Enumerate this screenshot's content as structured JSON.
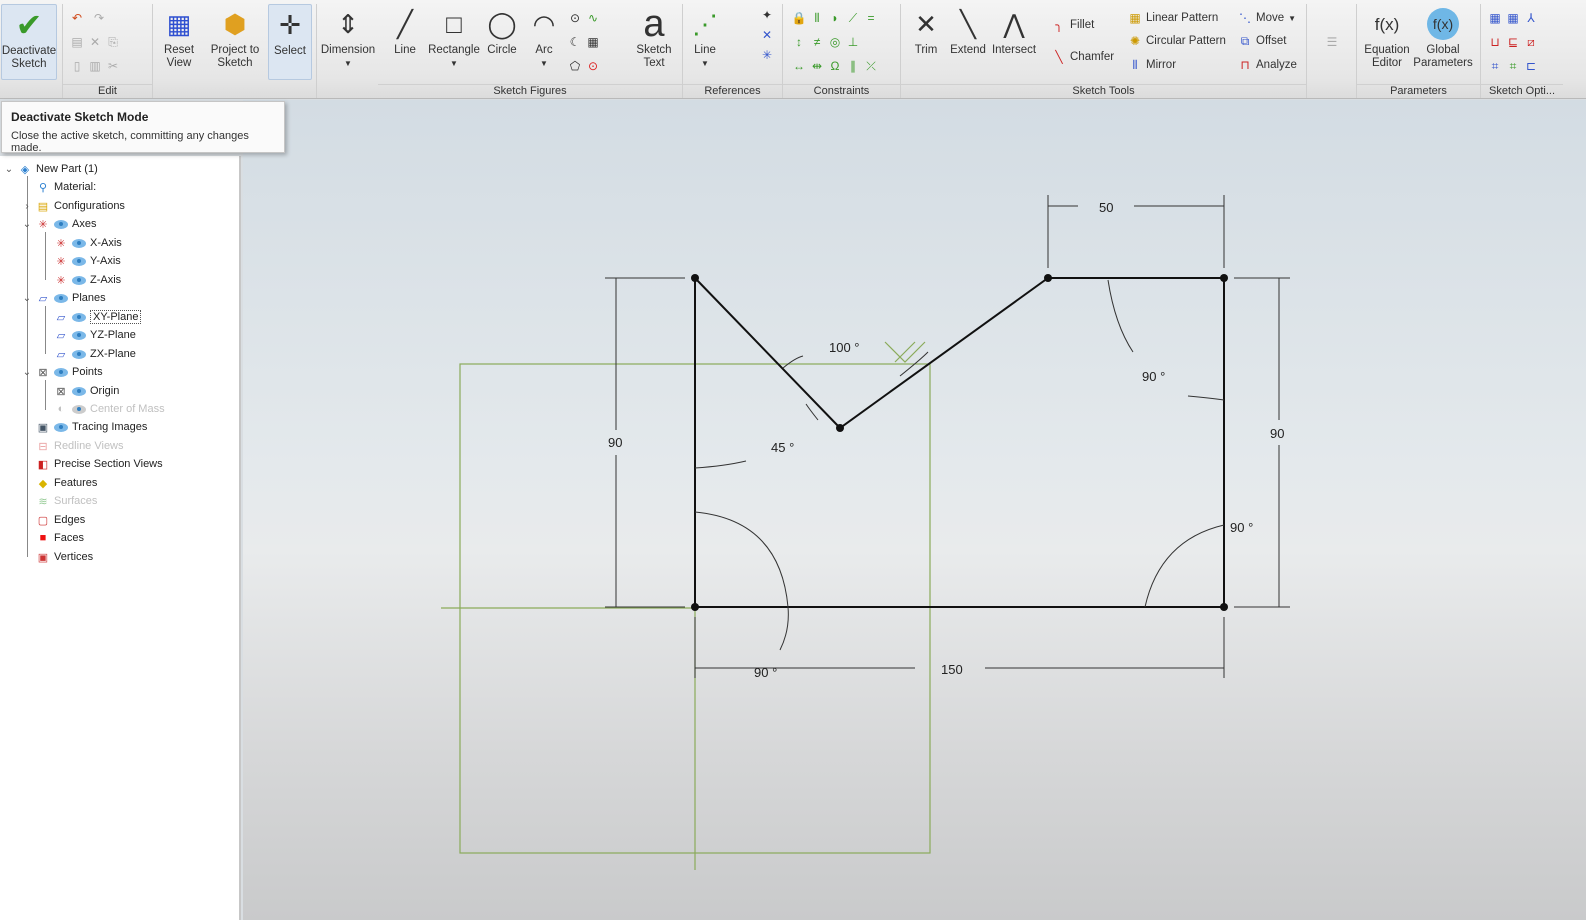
{
  "ribbon": {
    "deactivate": "Deactivate Sketch",
    "reset_view": "Reset View",
    "project": "Project to Sketch",
    "select": "Select",
    "dimension": "Dimension",
    "line": "Line",
    "rectangle": "Rectangle",
    "circle": "Circle",
    "arc": "Arc",
    "sketch_text": "Sketch Text",
    "ref_line": "Line",
    "trim": "Trim",
    "extend": "Extend",
    "intersect": "Intersect",
    "fillet": "Fillet",
    "chamfer": "Chamfer",
    "linear_pattern": "Linear Pattern",
    "circular_pattern": "Circular Pattern",
    "mirror": "Mirror",
    "move": "Move",
    "offset": "Offset",
    "analyze": "Analyze",
    "equation_editor": "Equation Editor",
    "global_parameters": "Global Parameters",
    "groups": {
      "edit": "Edit",
      "sketch_figures": "Sketch Figures",
      "references": "References",
      "constraints": "Constraints",
      "sketch_tools": "Sketch Tools",
      "parameters": "Parameters",
      "sketch_options": "Sketch Opti..."
    }
  },
  "tooltip": {
    "title": "Deactivate Sketch Mode",
    "desc": "Close the active sketch, committing any changes made."
  },
  "tree": {
    "root": "New Part (1)",
    "material": "Material:",
    "configurations": "Configurations",
    "axes": "Axes",
    "x_axis": "X-Axis",
    "y_axis": "Y-Axis",
    "z_axis": "Z-Axis",
    "planes": "Planes",
    "xy": "XY-Plane",
    "yz": "YZ-Plane",
    "zx": "ZX-Plane",
    "points": "Points",
    "origin": "Origin",
    "com": "Center of Mass",
    "tracing": "Tracing Images",
    "redline": "Redline Views",
    "section": "Precise Section Views",
    "features": "Features",
    "surfaces": "Surfaces",
    "edges": "Edges",
    "faces": "Faces",
    "vertices": "Vertices"
  },
  "dims": {
    "top_width": "50",
    "left_height": "90",
    "right_height": "90",
    "bottom_width": "150",
    "angle_v": "100 °",
    "angle_45": "45 °",
    "angle_tr": "90 °",
    "angle_br": "90 °",
    "angle_bl": "90 °"
  }
}
